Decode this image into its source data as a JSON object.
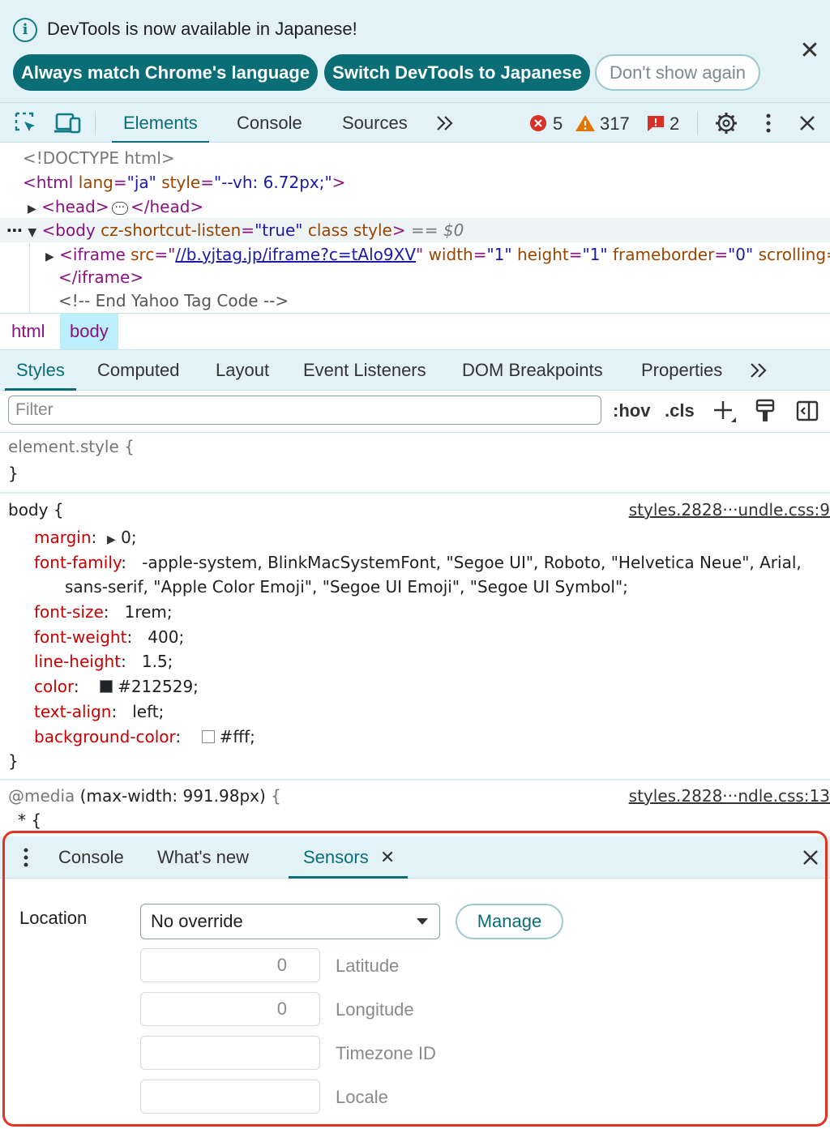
{
  "infobar": {
    "message": "DevTools is now available in Japanese!",
    "info_icon": "info-icon",
    "buttons": {
      "match_language": "Always match Chrome's language",
      "switch_japanese": "Switch DevTools to Japanese",
      "dont_show": "Don't show again"
    },
    "close_icon": "close-icon"
  },
  "toolbar": {
    "inspect_icon": "inspect-element-icon",
    "device_icon": "device-toolbar-icon",
    "tabs": [
      "Elements",
      "Console",
      "Sources"
    ],
    "active_tab": "Elements",
    "more_tabs": "»",
    "errors": "5",
    "warnings": "317",
    "issues": "2",
    "colors": {
      "error": "#d93025",
      "warning": "#e37400",
      "issue": "#d93025"
    }
  },
  "dom": {
    "doctype": "<!DOCTYPE html>",
    "html_open": {
      "tag": "<html",
      "attr1": "lang",
      "val1": "\"ja\"",
      "attr2": "style",
      "val2": "\"--vh: 6.72px;\"",
      "close": ">"
    },
    "head": {
      "open": "<head>",
      "ellipsis": "···",
      "close": "</head>"
    },
    "body_open": {
      "tag": "<body",
      "attr1": "cz-shortcut-listen",
      "val1": "\"true\"",
      "attr2": "class",
      "attr3": "style",
      "close": ">",
      "marker": "== $0"
    },
    "iframe": {
      "tag": "<iframe",
      "src_attr": "src",
      "src_val": "//b.yjtag.jp/iframe?c=tAlo9XV",
      "width_attr": "width",
      "width_val": "\"1\"",
      "height_attr": "height",
      "height_val": "\"1\"",
      "fb_attr": "frameborder",
      "fb_val": "\"0\"",
      "scroll_attr": "scrolling=\"",
      "close_tag": "</iframe>"
    },
    "comment": "<!-- End Yahoo Tag Code -->"
  },
  "breadcrumbs": [
    "html",
    "body"
  ],
  "styles_tabs": {
    "tabs": [
      "Styles",
      "Computed",
      "Layout",
      "Event Listeners",
      "DOM Breakpoints",
      "Properties"
    ],
    "active": "Styles",
    "more": "»"
  },
  "filter": {
    "placeholder": "Filter",
    "hov": ":hov",
    "cls": ".cls",
    "new_rule_icon": "plus-icon",
    "paint_icon": "paint-brush-icon",
    "sidebar_icon": "toggle-sidebar-icon"
  },
  "styles": {
    "element_style": {
      "selector": "element.style {",
      "close": "}"
    },
    "body_rule": {
      "selector": "body {",
      "source": "styles.2828···undle.css:9",
      "props": [
        {
          "name": "margin",
          "value": "0;",
          "has_triangle": true
        },
        {
          "name": "font-family",
          "value": "-apple-system, BlinkMacSystemFont, \"Segoe UI\", Roboto, \"Helvetica Neue\", Arial,",
          "continuation": "sans-serif, \"Apple Color Emoji\", \"Segoe UI Emoji\", \"Segoe UI Symbol\";"
        },
        {
          "name": "font-size",
          "value": "1rem;"
        },
        {
          "name": "font-weight",
          "value": "400;"
        },
        {
          "name": "line-height",
          "value": "1.5;"
        },
        {
          "name": "color",
          "value": "#212529;",
          "swatch": "#212529"
        },
        {
          "name": "text-align",
          "value": "left;"
        },
        {
          "name": "background-color",
          "value": "#fff;",
          "swatch": "#ffffff"
        }
      ],
      "close": "}"
    },
    "media_rule": {
      "at": "@media",
      "query": "(max-width: 991.98px)",
      "brace": "{",
      "source": "styles.2828···ndle.css:13",
      "next_selector": "* {"
    }
  },
  "drawer": {
    "menu_icon": "kebab-menu-icon",
    "tabs": [
      "Console",
      "What's new",
      "Sensors"
    ],
    "active": "Sensors",
    "tab_close_icon": "close-tab-icon",
    "close_icon": "close-drawer-icon",
    "location": {
      "label": "Location",
      "select_value": "No override",
      "manage_button": "Manage",
      "latitude": {
        "value": "0",
        "label": "Latitude"
      },
      "longitude": {
        "value": "0",
        "label": "Longitude"
      },
      "timezone": {
        "value": "",
        "label": "Timezone ID"
      },
      "locale": {
        "value": "",
        "label": "Locale"
      }
    },
    "highlight_color": "#e53321"
  }
}
